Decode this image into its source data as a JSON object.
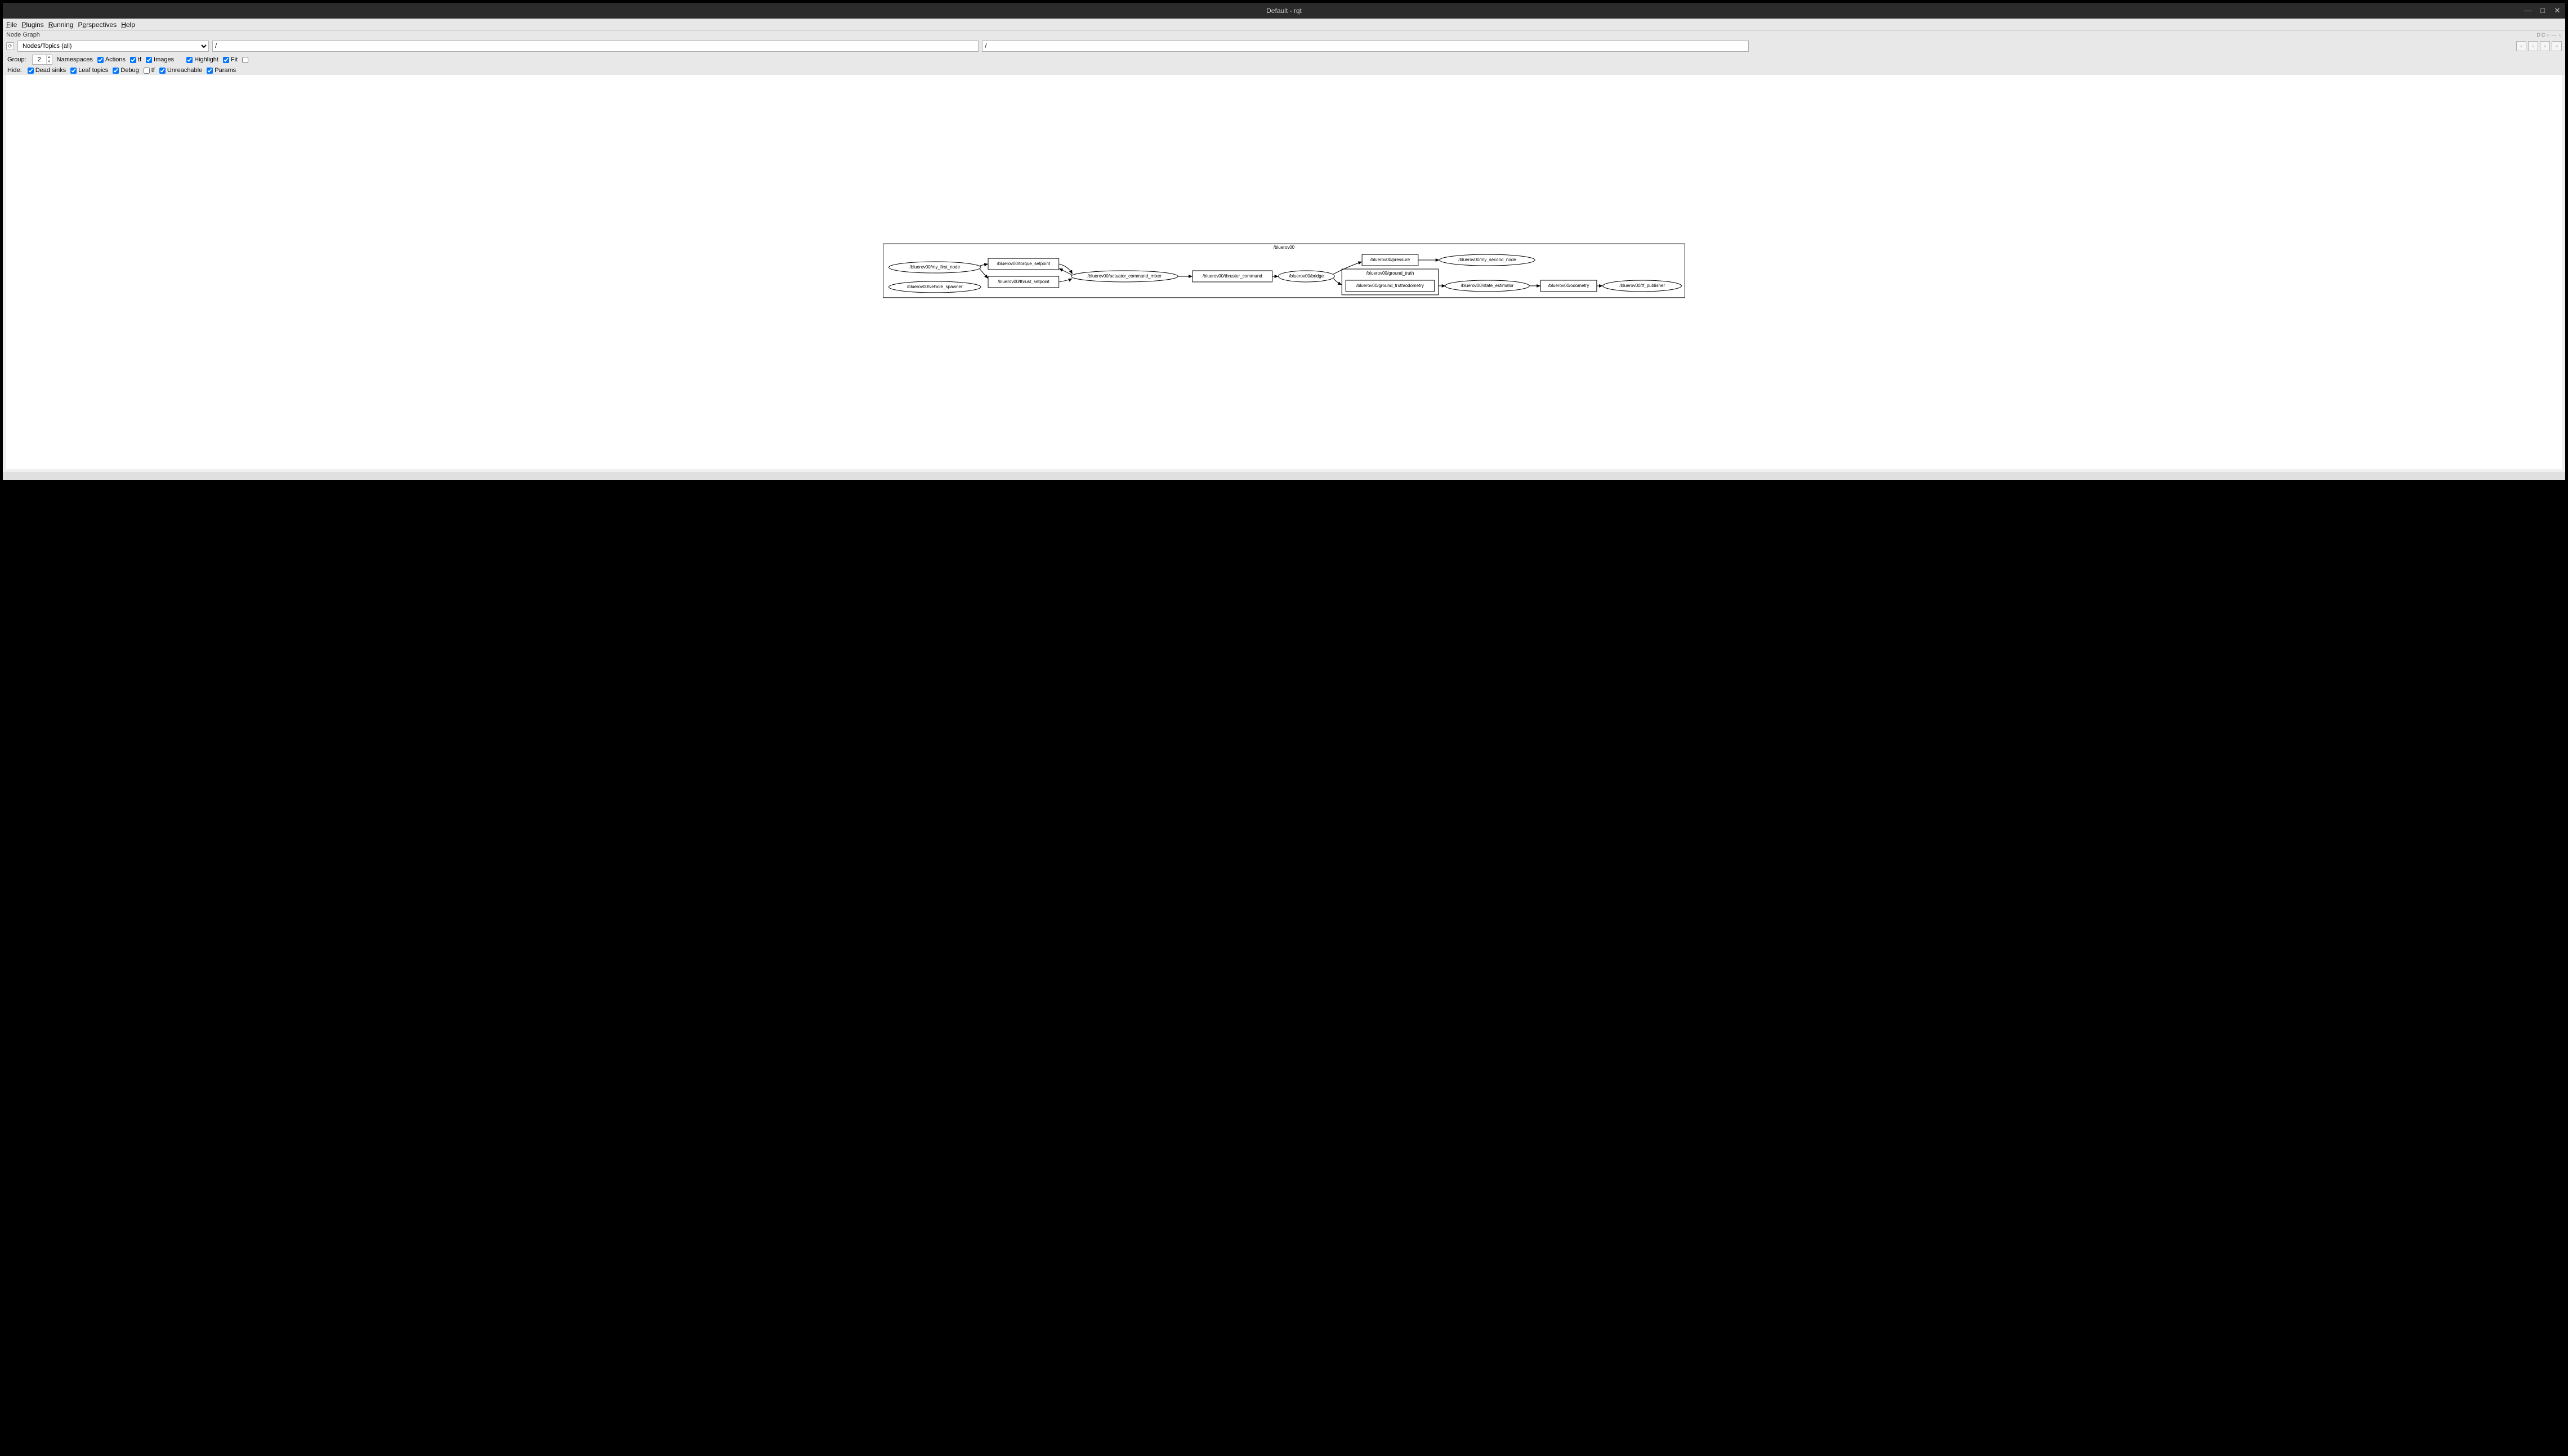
{
  "window": {
    "title": "Default - rqt"
  },
  "menubar": {
    "file": "File",
    "plugins": "Plugins",
    "running": "Running",
    "perspectives": "Perspectives",
    "help": "Help"
  },
  "panel": {
    "label": "Node Graph"
  },
  "toolbar": {
    "view_select": "Nodes/Topics (all)",
    "filter1": "/",
    "filter2": "/"
  },
  "group_row": {
    "label": "Group:",
    "value": "2",
    "namespaces": "Namespaces",
    "actions": "Actions",
    "tf": "tf",
    "images": "Images",
    "highlight": "Highlight",
    "fit": "Fit"
  },
  "hide_row": {
    "label": "Hide:",
    "dead_sinks": "Dead sinks",
    "leaf_topics": "Leaf topics",
    "debug": "Debug",
    "tf": "tf",
    "unreachable": "Unreachable",
    "params": "Params"
  },
  "graph": {
    "cluster": "/bluerov00",
    "ground_truth_cluster": "/bluerov00/ground_truth",
    "nodes": {
      "my_first_node": "/bluerov00/my_first_node",
      "vehicle_spawner": "/bluerov00/vehicle_spawner",
      "torque_setpoint": "/bluerov00/torque_setpoint",
      "thrust_setpoint": "/bluerov00/thrust_setpoint",
      "actuator_command_mixer": "/bluerov00/actuator_command_mixer",
      "thruster_command": "/bluerov00/thruster_command",
      "bridge": "/bluerov00/bridge",
      "pressure": "/bluerov00/pressure",
      "ground_truth_odometry": "/bluerov00/ground_truth/odometry",
      "my_second_node": "/bluerov00/my_second_node",
      "state_estimator": "/bluerov00/state_estimator",
      "odometry": "/bluerov00/odometry",
      "tf_publisher": "/bluerov00/tf_publisher"
    }
  }
}
